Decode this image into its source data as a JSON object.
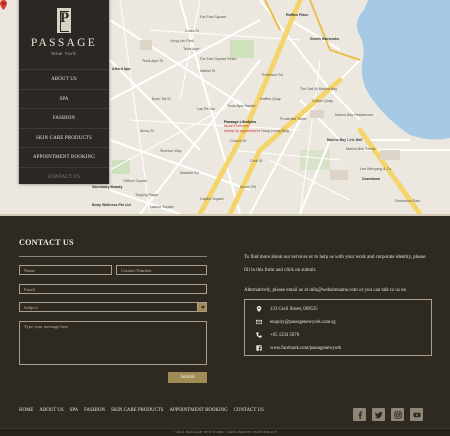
{
  "brand": {
    "name": "PASSAGE",
    "tagline": "New York"
  },
  "nav": {
    "items": [
      {
        "label": "ABOUT US"
      },
      {
        "label": "SPA"
      },
      {
        "label": "FASHION"
      },
      {
        "label": "SKIN CARE PRODUCTS"
      },
      {
        "label": "APPOINTMENT BOOKING"
      },
      {
        "label": "CONTACT US"
      }
    ]
  },
  "map": {
    "marker": {
      "title": "Passage Lifestyles",
      "subtitle_1": "facial treatment",
      "subtitle_2": "strictly by appointment"
    },
    "labels": [
      "Raffles Place",
      "Telok Ayer",
      "Marina Bay Link Mall",
      "Lau Pa Sat",
      "Clifford Square",
      "Downtown",
      "Shenton Way",
      "Tanjong Pagar",
      "Far East Square",
      "Lee Wenyang & Co",
      "Zenith Hairworks",
      "Marina Bay Sands",
      "Collyer Quay",
      "Market St",
      "The Sail @ Marina Bay",
      "Marina Bay Residences",
      "Telok Ayer Market",
      "Robinson Rd",
      "Cecil St",
      "Cross St",
      "Amoy St",
      "Boon Tat St",
      "Telok Ayer St",
      "Hong Leong Bldg",
      "Prudential Tower",
      "Hong Lim Park",
      "Sanctuary Beauty",
      "Body Wellness Pte Ltd",
      "Labour Square",
      "Capitol Square",
      "Maxwell Rd",
      "Anson Rd",
      "Downtown East",
      "Afford Spa",
      "Far East Square Resto",
      "Raffles Quay",
      "Church St"
    ]
  },
  "contact": {
    "title": "CONTACT US",
    "form": {
      "name_placeholder": "Name",
      "contact_placeholder": "Contact Number",
      "email_placeholder": "Email",
      "subject_placeholder": "Subject",
      "message_placeholder": "Type your message here",
      "submit_label": "Submit"
    },
    "intro_line_1": "To find more about our services or to help us with your work and corporate identity, please",
    "intro_line_2": "fill in this form and click on submit.",
    "intro_line_3": "Alternatively, please email us at info@websitename.com or you can talk to us on",
    "info": {
      "address": "133 Cecil Street, 069535",
      "email": "enquiry@passagenewyork.com.sg",
      "phone": "+65 1234 5678",
      "facebook": "www.facebook.com/passagenewyork"
    }
  },
  "footer": {
    "nav": [
      "HOME",
      "ABOUT US",
      "SPA",
      "FASHION",
      "SKIN CARE PRODUCTS",
      "APPOINTMENT BOOKING",
      "CONTACT US"
    ],
    "copyright": "© 2014 PASSAGE NEW YORK | DATA PROTECTION POLICY",
    "social": [
      "facebook-icon",
      "twitter-icon",
      "instagram-icon",
      "youtube-icon"
    ]
  },
  "colors": {
    "background": "#2e2a22",
    "sidebar": "#2b2824",
    "accent": "#a08a55",
    "map_land": "#ece8df",
    "map_water": "#a6c9e6",
    "map_road_yellow": "#f3d56b",
    "marker": "#d93a32"
  }
}
